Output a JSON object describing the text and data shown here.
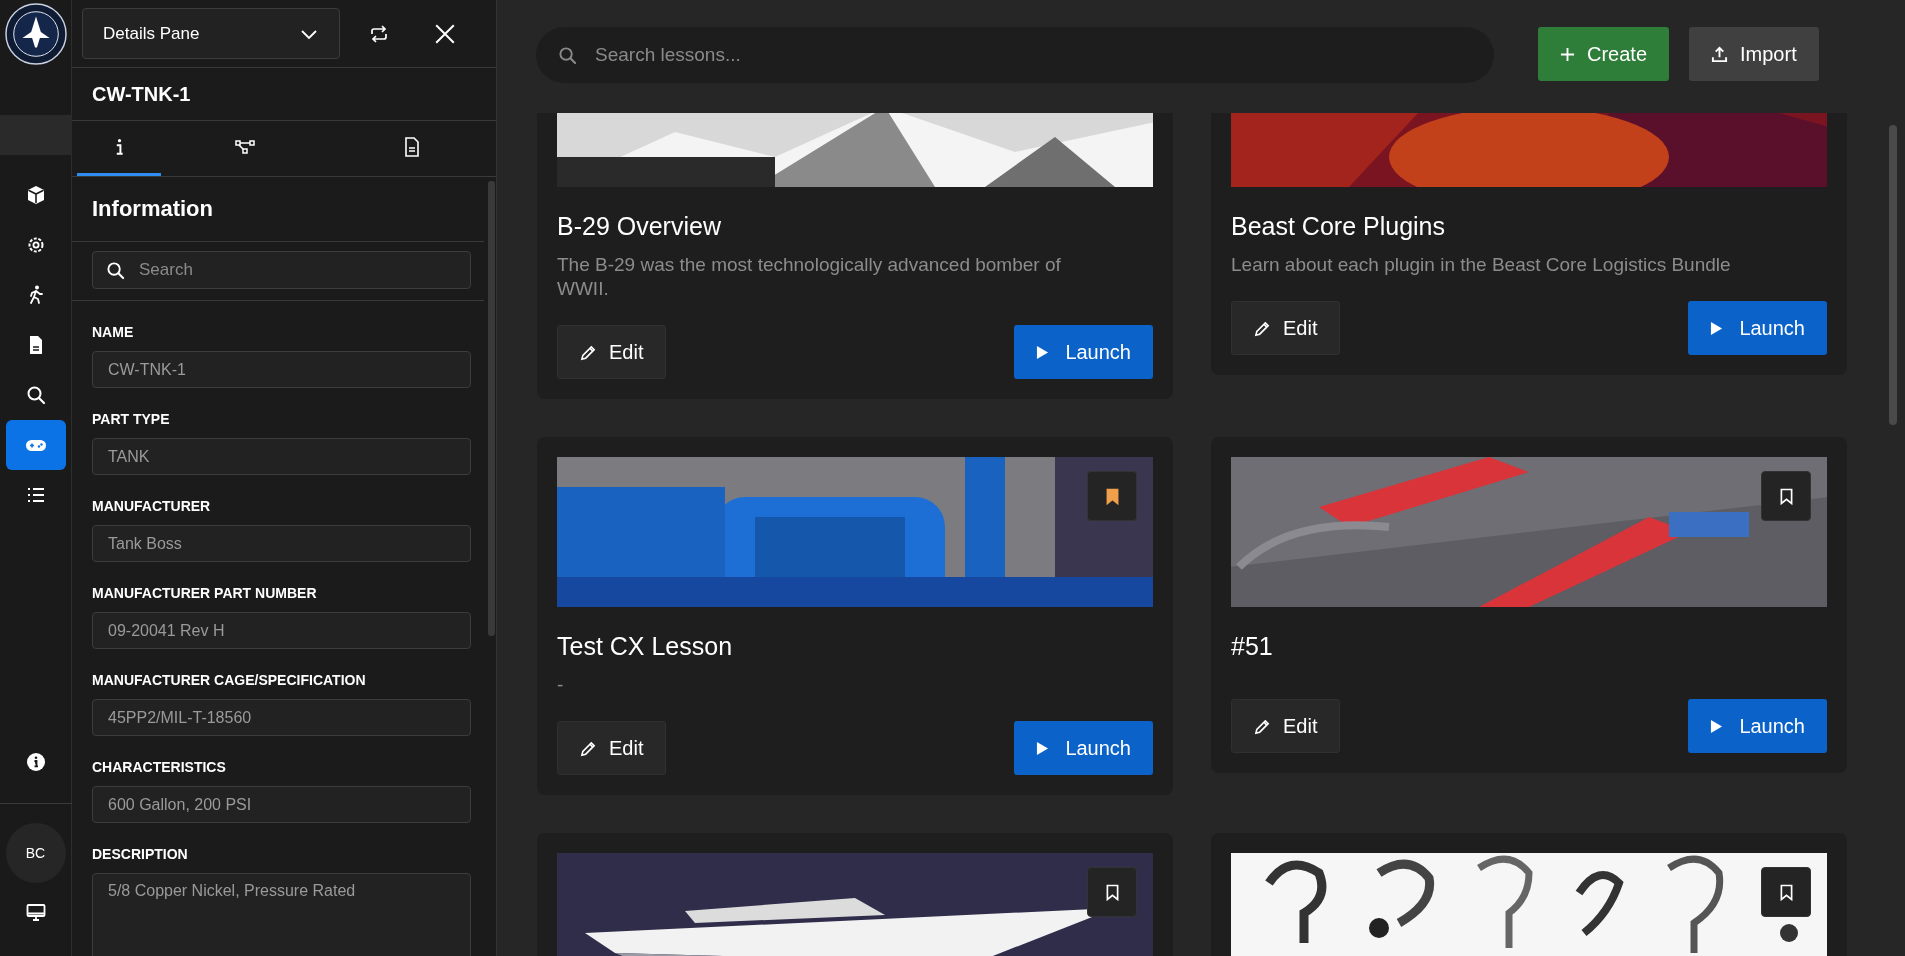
{
  "rail": {
    "top_items": [
      {
        "kind": "cube",
        "selected": false
      },
      {
        "kind": "gear",
        "selected": false
      },
      {
        "kind": "walker",
        "selected": false
      },
      {
        "kind": "document",
        "selected": false
      },
      {
        "kind": "search",
        "selected": false
      },
      {
        "kind": "gamepad",
        "selected": true
      },
      {
        "kind": "list",
        "selected": false
      }
    ],
    "bottom_items": [
      {
        "kind": "info",
        "selected": false
      }
    ],
    "avatar": "BC",
    "footer_items": [
      {
        "kind": "monitor",
        "selected": false
      }
    ]
  },
  "details_pane": {
    "dropdown": "Details Pane",
    "title": "CW-TNK-1",
    "tabs": [
      {
        "kind": "info",
        "selected": true
      },
      {
        "kind": "graph",
        "selected": false
      },
      {
        "kind": "document",
        "selected": false
      }
    ],
    "section_title": "Information",
    "search": {
      "placeholder": "Search"
    },
    "fields": [
      {
        "label": "NAME",
        "value": "CW-TNK-1",
        "kind": "input"
      },
      {
        "label": "PART TYPE",
        "value": "TANK",
        "kind": "input"
      },
      {
        "label": "MANUFACTURER",
        "value": "Tank Boss",
        "kind": "input"
      },
      {
        "label": "MANUFACTURER PART NUMBER",
        "value": "09-20041 Rev H",
        "kind": "input"
      },
      {
        "label": "MANUFACTURER CAGE/SPECIFICATION",
        "value": "45PP2/MIL-T-18560",
        "kind": "input"
      },
      {
        "label": "CHARACTERISTICS",
        "value": "600 Gallon, 200 PSI",
        "kind": "input"
      },
      {
        "label": "DESCRIPTION",
        "value": "5/8 Copper Nickel, Pressure Rated",
        "kind": "textarea"
      }
    ]
  },
  "main": {
    "search": {
      "placeholder": "Search lessons..."
    },
    "buttons": [
      {
        "label": "Create",
        "kind": "create"
      },
      {
        "label": "Import",
        "kind": "import"
      }
    ],
    "lessons": [
      {
        "title": "B-29 Overview",
        "description": "The B-29 was the most technologically advanced bomber of WWII.",
        "edit": "Edit",
        "launch": "Launch"
      },
      {
        "title": "Beast Core Plugins",
        "description": "Learn about each plugin in the Beast Core Logistics Bundle",
        "edit": "Edit",
        "launch": "Launch"
      },
      {
        "title": "Test CX Lesson",
        "description": "-",
        "edit": "Edit",
        "launch": "Launch",
        "bookmarked": true
      },
      {
        "title": "#51",
        "edit": "Edit",
        "launch": "Launch",
        "bookmarked": false
      },
      {
        "bookmarked": false
      },
      {
        "bookmarked": false
      }
    ]
  }
}
